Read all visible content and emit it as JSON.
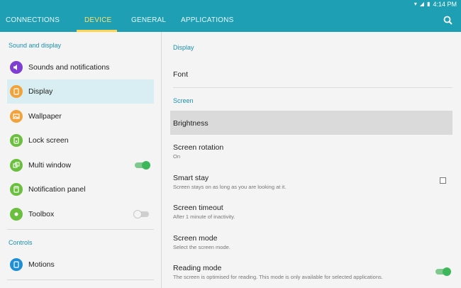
{
  "status_bar": {
    "time": "4:14 PM",
    "wifi_icon": "wifi-icon",
    "signal_icon": "signal-icon",
    "battery_icon": "battery-icon"
  },
  "tabs": [
    {
      "label": "CONNECTIONS",
      "active": false
    },
    {
      "label": "DEVICE",
      "active": true
    },
    {
      "label": "GENERAL",
      "active": false
    },
    {
      "label": "APPLICATIONS",
      "active": false
    }
  ],
  "colors": {
    "accent": "#1e9fb4",
    "active_tab": "#ffd54f",
    "section_header": "#1a8fb0",
    "selected_bg": "#d9eef2"
  },
  "left": {
    "section1": "Sound and display",
    "section2": "Controls",
    "items": [
      {
        "label": "Sounds and notifications",
        "icon": "speaker-icon",
        "color": "#7e3fd1"
      },
      {
        "label": "Display",
        "icon": "display-icon",
        "color": "#f2a23a",
        "selected": true
      },
      {
        "label": "Wallpaper",
        "icon": "wallpaper-icon",
        "color": "#f2a23a"
      },
      {
        "label": "Lock screen",
        "icon": "lock-screen-icon",
        "color": "#6bbf3f"
      },
      {
        "label": "Multi window",
        "icon": "multi-window-icon",
        "color": "#6bbf3f",
        "toggle": true
      },
      {
        "label": "Notification panel",
        "icon": "notification-panel-icon",
        "color": "#6bbf3f"
      },
      {
        "label": "Toolbox",
        "icon": "toolbox-icon",
        "color": "#6bbf3f",
        "toggle": false
      },
      {
        "label": "Motions",
        "icon": "motions-icon",
        "color": "#1e8ed6"
      }
    ]
  },
  "right": {
    "section_display": "Display",
    "section_screen": "Screen",
    "font": {
      "title": "Font"
    },
    "brightness": {
      "title": "Brightness"
    },
    "screen_rotation": {
      "title": "Screen rotation",
      "subtitle": "On"
    },
    "smart_stay": {
      "title": "Smart stay",
      "subtitle": "Screen stays on as long as you are looking at it.",
      "checked": false
    },
    "screen_timeout": {
      "title": "Screen timeout",
      "subtitle": "After 1 minute of inactivity."
    },
    "screen_mode": {
      "title": "Screen mode",
      "subtitle": "Select the screen mode."
    },
    "reading_mode": {
      "title": "Reading mode",
      "subtitle": "The screen is optimised for reading. This mode is only available for selected applications.",
      "toggle": true
    }
  }
}
